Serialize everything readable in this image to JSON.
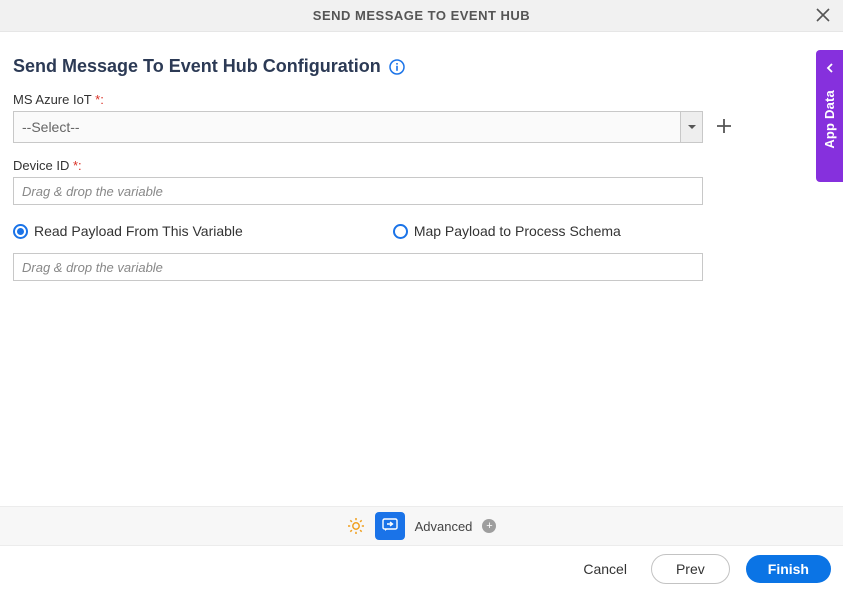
{
  "header": {
    "title": "SEND MESSAGE TO EVENT HUB"
  },
  "page": {
    "title": "Send Message To Event Hub Configuration"
  },
  "fields": {
    "azure_label": "MS Azure IoT ",
    "azure_select_value": "--Select--",
    "device_label": "Device ID ",
    "device_placeholder": "Drag & drop the variable",
    "variable_placeholder": "Drag & drop the variable",
    "required_colon": "*:"
  },
  "radios": {
    "read_label": "Read Payload From This Variable",
    "map_label": "Map Payload to Process Schema"
  },
  "sidebar": {
    "label": "App Data"
  },
  "footer": {
    "advanced_label": "Advanced"
  },
  "actions": {
    "cancel": "Cancel",
    "prev": "Prev",
    "finish": "Finish"
  }
}
